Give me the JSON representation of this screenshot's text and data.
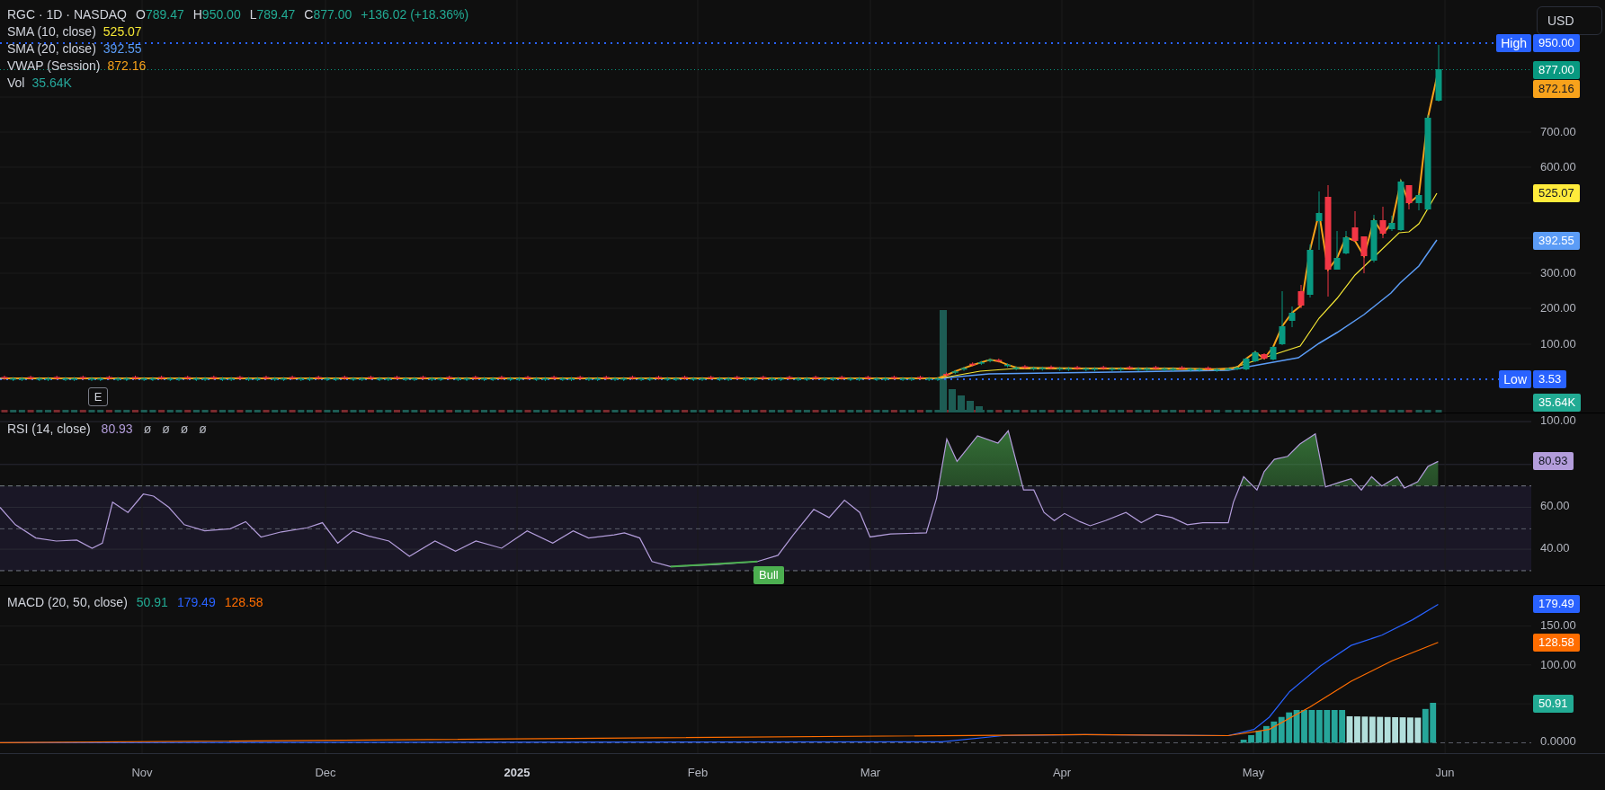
{
  "header": {
    "symbol": "RGC · 1D · NASDAQ",
    "ohlc": [
      {
        "key": "O",
        "value": "789.47"
      },
      {
        "key": "H",
        "value": "950.00"
      },
      {
        "key": "L",
        "value": "789.47"
      },
      {
        "key": "C",
        "value": "877.00"
      }
    ],
    "change": "+136.02 (+18.36%)"
  },
  "currency_button": "USD",
  "price_indicators": [
    {
      "name": "SMA (10, close)",
      "value": "525.07",
      "color": "#f5e735"
    },
    {
      "name": "SMA (20, close)",
      "value": "392.55",
      "color": "#5b9cf6"
    },
    {
      "name": "VWAP (Session)",
      "value": "872.16",
      "color": "#f7a21b"
    },
    {
      "name": "Vol",
      "value": "35.64K",
      "color": "#26a69a"
    }
  ],
  "earnings_marker": "E",
  "price_axis": {
    "ticks": [
      "700.00",
      "600.00",
      "300.00",
      "200.00",
      "100.00"
    ],
    "labels": [
      {
        "text": "950.00",
        "color": "#2962ff",
        "tag": "High"
      },
      {
        "text": "877.00",
        "color": "#089981"
      },
      {
        "text": "872.16",
        "color": "#f7a21b"
      },
      {
        "text": "525.07",
        "color": "#ffeb3b"
      },
      {
        "text": "392.55",
        "color": "#5b9cf6"
      },
      {
        "text": "3.53",
        "color": "#2962ff",
        "tag": "Low"
      },
      {
        "text": "35.64K",
        "color": "#22ab94"
      }
    ]
  },
  "rsi": {
    "title": "RSI (14, close)",
    "value": {
      "text": "80.93",
      "color": "#b39ddb"
    },
    "extras": [
      "ø",
      "ø",
      "ø",
      "ø"
    ],
    "ticks": [
      "100.00",
      "60.00",
      "40.00"
    ],
    "label": {
      "text": "80.93",
      "color": "#b39ddb"
    },
    "divergence_label": "Bull"
  },
  "macd": {
    "title": "MACD (20, 50, close)",
    "values": [
      {
        "value": "50.91",
        "color": "#22ab94"
      },
      {
        "value": "179.49",
        "color": "#2962ff"
      },
      {
        "value": "128.58",
        "color": "#ff6d00"
      }
    ],
    "ticks": [
      "150.00",
      "100.00",
      "0.0000"
    ],
    "labels": [
      {
        "text": "179.49",
        "color": "#2962ff"
      },
      {
        "text": "128.58",
        "color": "#ff6d00"
      },
      {
        "text": "50.91",
        "color": "#22ab94"
      }
    ]
  },
  "time_axis": [
    {
      "label": "Nov",
      "bold": false
    },
    {
      "label": "Dec",
      "bold": false
    },
    {
      "label": "2025",
      "bold": true
    },
    {
      "label": "Feb",
      "bold": false
    },
    {
      "label": "Mar",
      "bold": false
    },
    {
      "label": "Apr",
      "bold": false
    },
    {
      "label": "May",
      "bold": false
    },
    {
      "label": "Jun",
      "bold": false
    }
  ]
}
